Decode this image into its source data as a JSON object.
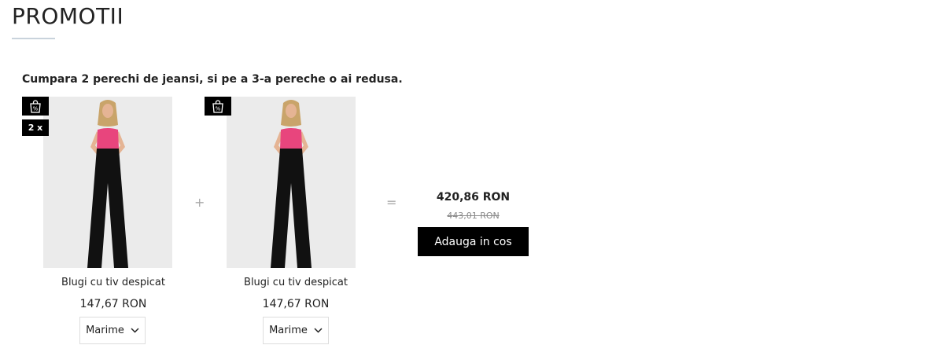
{
  "section": {
    "title": "PROMOTII"
  },
  "promo": {
    "description": "Cumpara 2 perechi de jeansi, si pe a 3-a pereche o ai redusa.",
    "operator_plus": "+",
    "operator_equals": "=",
    "total_price": "420,86 RON",
    "old_price": "443,01 RON",
    "add_to_cart_label": "Adauga in cos"
  },
  "products": [
    {
      "name": "Blugi cu tiv despicat",
      "price": "147,67 RON",
      "quantity_badge": "2 x",
      "size_label": "Marime",
      "badge_icon": "discount-bag-icon"
    },
    {
      "name": "Blugi cu tiv despicat",
      "price": "147,67 RON",
      "size_label": "Marime",
      "badge_icon": "discount-bag-icon"
    }
  ],
  "colors": {
    "button_bg": "#000000",
    "button_text": "#ffffff",
    "underline": "#c9d3dc",
    "top_pink": "#e8457d",
    "jeans_black": "#111111"
  }
}
